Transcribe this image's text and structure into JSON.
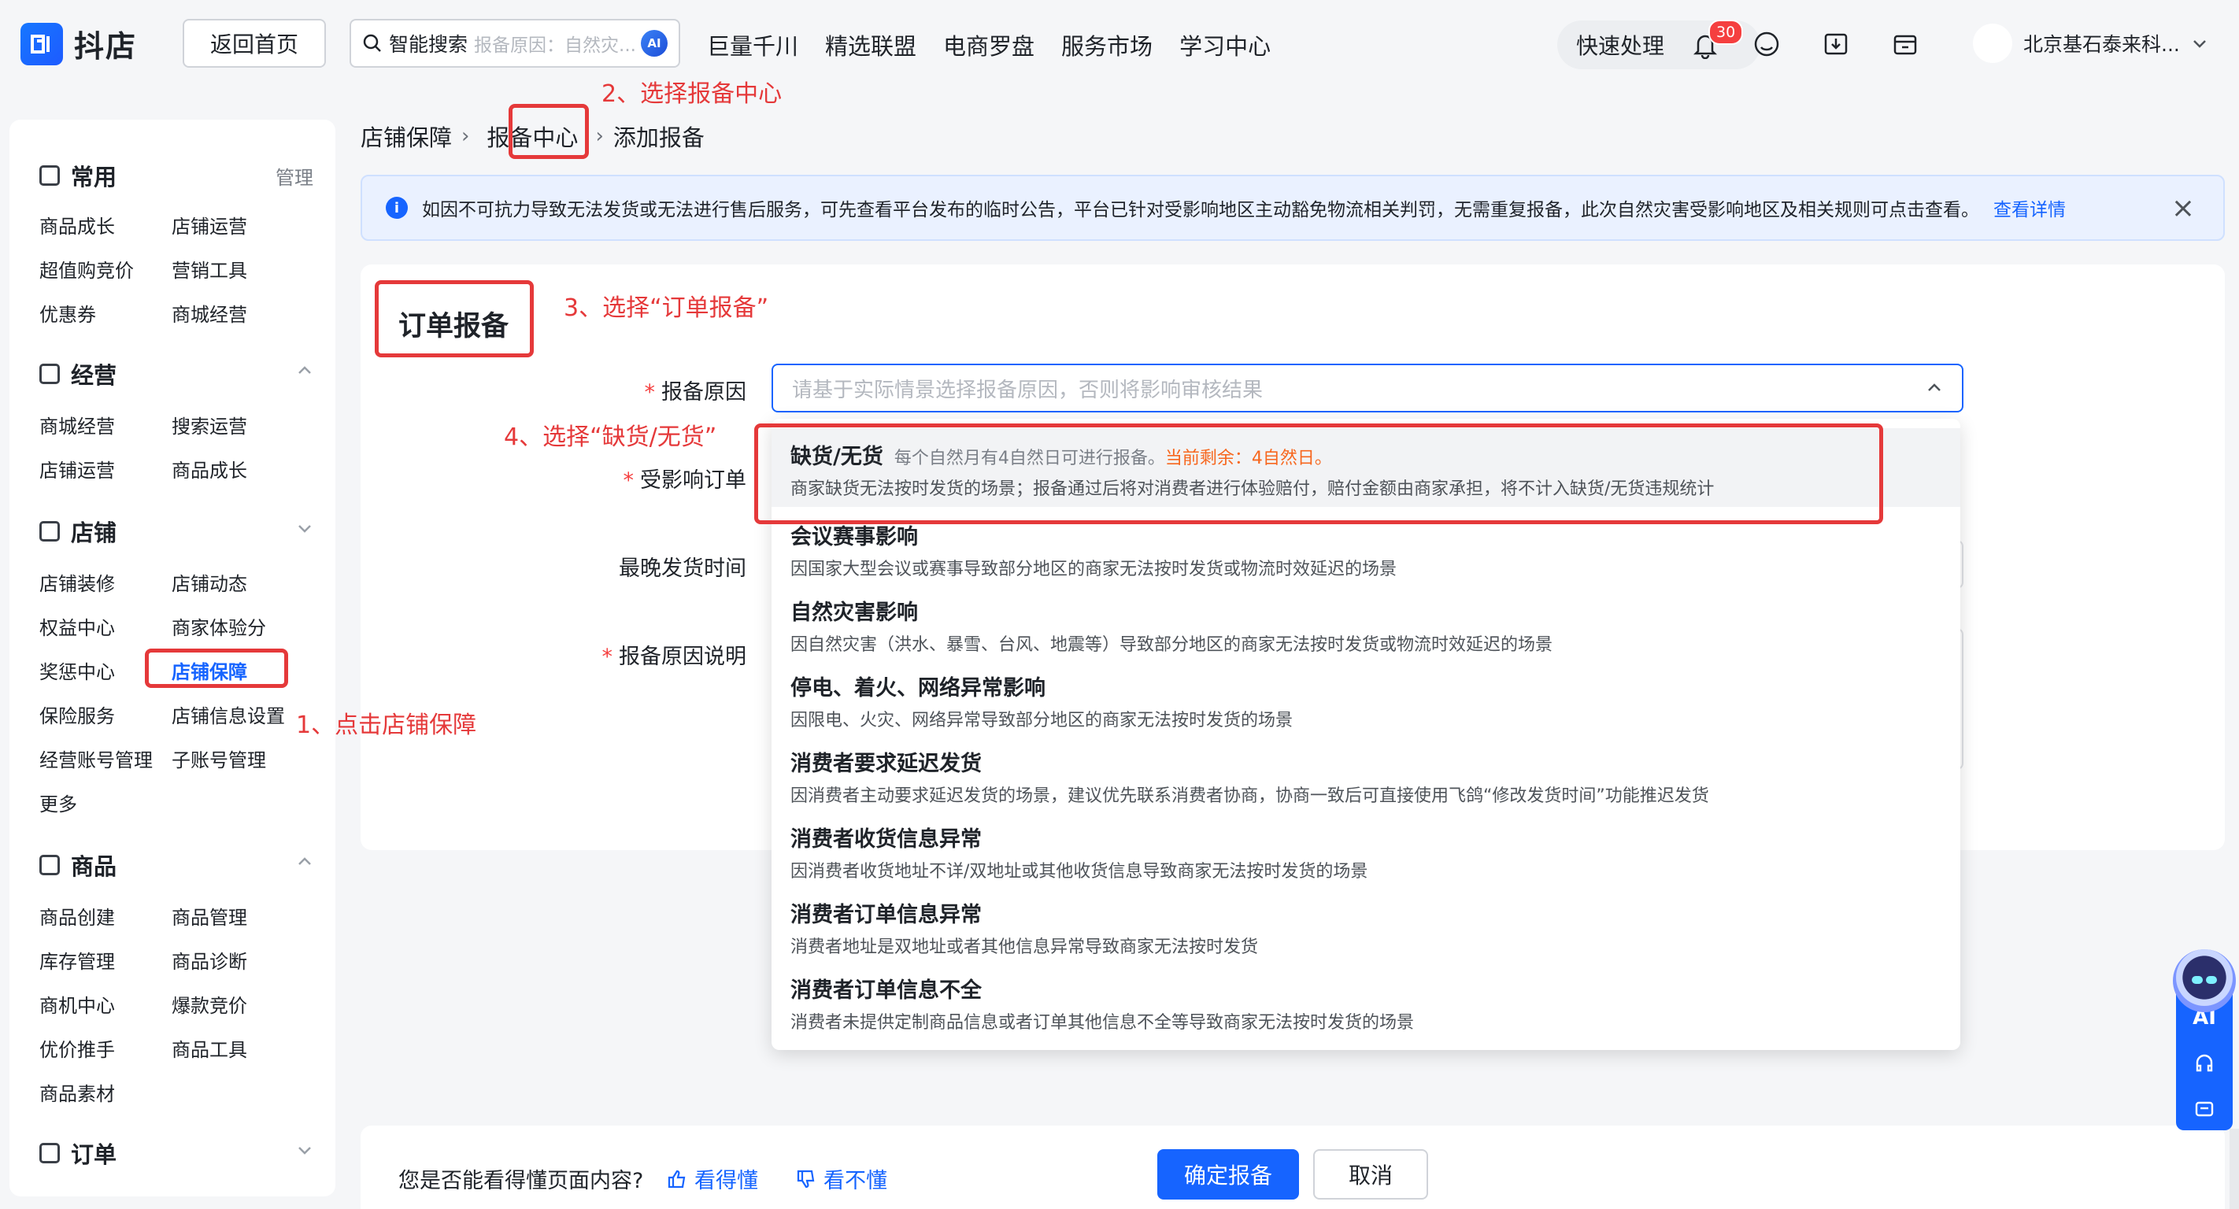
{
  "header": {
    "logo_text": "抖店",
    "home_button": "返回首页",
    "search_label": "智能搜索",
    "search_placeholder": "报备原因：自然灾...",
    "ai_badge": "AI",
    "nav": [
      "巨量千川",
      "精选联盟",
      "电商罗盘",
      "服务市场",
      "学习中心"
    ],
    "quick_label": "快速处理",
    "notification_count": "30",
    "user_name": "北京基石泰来科..."
  },
  "sidebar": {
    "groups": [
      {
        "title": "常用",
        "right": "管理",
        "items": [
          "商品成长",
          "店铺运营",
          "超值购竞价",
          "营销工具",
          "优惠券",
          "商城经营"
        ]
      },
      {
        "title": "经营",
        "items": [
          "商城经营",
          "搜索运营",
          "店铺运营",
          "商品成长"
        ]
      },
      {
        "title": "店铺",
        "items": [
          "店铺装修",
          "店铺动态",
          "权益中心",
          "商家体验分",
          "奖惩中心",
          "店铺保障",
          "保险服务",
          "店铺信息设置",
          "经营账号管理",
          "子账号管理",
          "更多"
        ]
      },
      {
        "title": "商品",
        "items": [
          "商品创建",
          "商品管理",
          "库存管理",
          "商品诊断",
          "商机中心",
          "爆款竞价",
          "优价推手",
          "商品工具",
          "商品素材"
        ]
      },
      {
        "title": "订单",
        "items": []
      }
    ]
  },
  "breadcrumb": [
    "店铺保障",
    "报备中心",
    "添加报备"
  ],
  "notice": {
    "text": "如因不可抗力导致无法发货或无法进行售后服务，可先查看平台发布的临时公告，平台已针对受影响地区主动豁免物流相关判罚，无需重复报备，此次自然灾害受影响地区及相关规则可点击查看。",
    "link": "查看详情"
  },
  "form": {
    "title": "订单报备",
    "reason_label": "报备原因",
    "reason_placeholder": "请基于实际情景选择报备原因，否则将影响审核结果",
    "orders_label": "受影响订单",
    "ship_time_label": "最晚发货时间",
    "desc_label": "报备原因说明"
  },
  "dropdown": {
    "options": [
      {
        "title": "缺货/无货",
        "hint": "每个自然月有4自然日可进行报备。",
        "remaining": "当前剩余：4自然日。",
        "desc": "商家缺货无法按时发货的场景；报备通过后将对消费者进行体验赔付，赔付金额由商家承担，将不计入缺货/无货违规统计"
      },
      {
        "title": "会议赛事影响",
        "desc": "因国家大型会议或赛事导致部分地区的商家无法按时发货或物流时效延迟的场景"
      },
      {
        "title": "自然灾害影响",
        "desc": "因自然灾害（洪水、暴雪、台风、地震等）导致部分地区的商家无法按时发货或物流时效延迟的场景"
      },
      {
        "title": "停电、着火、网络异常影响",
        "desc": "因限电、火灾、网络异常导致部分地区的商家无法按时发货的场景"
      },
      {
        "title": "消费者要求延迟发货",
        "desc": "因消费者主动要求延迟发货的场景，建议优先联系消费者协商，协商一致后可直接使用飞鸽“修改发货时间”功能推迟发货"
      },
      {
        "title": "消费者收货信息异常",
        "desc": "因消费者收货地址不详/双地址或其他收货信息导致商家无法按时发货的场景"
      },
      {
        "title": "消费者订单信息异常",
        "desc": "消费者地址是双地址或者其他信息异常导致商家无法按时发货"
      },
      {
        "title": "消费者订单信息不全",
        "desc": "消费者未提供定制商品信息或者订单其他信息不全等导致商家无法按时发货的场景"
      }
    ]
  },
  "annotations": {
    "step1": "1、点击店铺保障",
    "step2": "2、选择报备中心",
    "step3": "3、选择“订单报备”",
    "step4": "4、选择“缺货/无货”"
  },
  "footer": {
    "question": "您是否能看得懂页面内容?",
    "yes": "看得懂",
    "no": "看不懂",
    "confirm": "确定报备",
    "cancel": "取消"
  },
  "assistant": {
    "label": "AI"
  },
  "colors": {
    "primary": "#1664ff",
    "annotation": "#e5393a",
    "warning": "#f7671e"
  }
}
